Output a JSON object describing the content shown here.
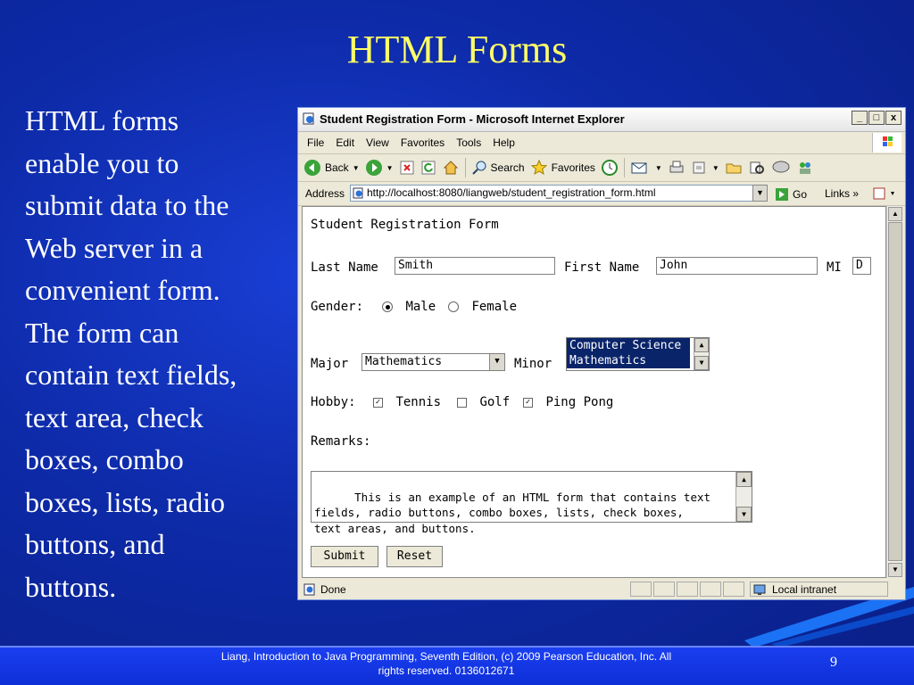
{
  "slide": {
    "title": "HTML Forms",
    "body_lines": [
      "HTML forms",
      "enable you to",
      "submit data to the",
      "Web server in a",
      "convenient form.",
      "The form can",
      "contain text fields,",
      "text area, check",
      "boxes, combo",
      "boxes, lists, radio",
      "buttons, and",
      "buttons."
    ],
    "footer_line1": "Liang, Introduction to Java Programming, Seventh Edition, (c) 2009 Pearson Education, Inc. All",
    "footer_line2": "rights reserved. 0136012671",
    "page_number": "9"
  },
  "browser": {
    "window_title": "Student Registration Form - Microsoft Internet Explorer",
    "window_buttons": [
      "_",
      "□",
      "x"
    ],
    "menu": [
      "File",
      "Edit",
      "View",
      "Favorites",
      "Tools",
      "Help"
    ],
    "toolbar": {
      "back": "Back",
      "search": "Search",
      "favorites": "Favorites"
    },
    "address_label": "Address",
    "url": "http://localhost:8080/liangweb/student_registration_form.html",
    "go": "Go",
    "links": "Links",
    "status": "Done",
    "zone": "Local intranet"
  },
  "form": {
    "heading": "Student Registration Form",
    "last_name_label": "Last Name",
    "last_name_value": "Smith",
    "first_name_label": "First Name",
    "first_name_value": "John",
    "mi_label": "MI",
    "mi_value": "D",
    "gender_label": "Gender:",
    "gender_male": "Male",
    "gender_female": "Female",
    "major_label": "Major",
    "major_value": "Mathematics",
    "minor_label": "Minor",
    "minor_options": [
      "Computer Science",
      "Mathematics"
    ],
    "hobby_label": "Hobby:",
    "hobbies": [
      {
        "label": "Tennis",
        "checked": true
      },
      {
        "label": "Golf",
        "checked": false
      },
      {
        "label": "Ping Pong",
        "checked": true
      }
    ],
    "remarks_label": "Remarks:",
    "remarks_text": "This is an example of an HTML form that contains text\nfields, radio buttons, combo boxes, lists, check boxes,\ntext areas, and buttons.",
    "submit": "Submit",
    "reset": "Reset"
  }
}
